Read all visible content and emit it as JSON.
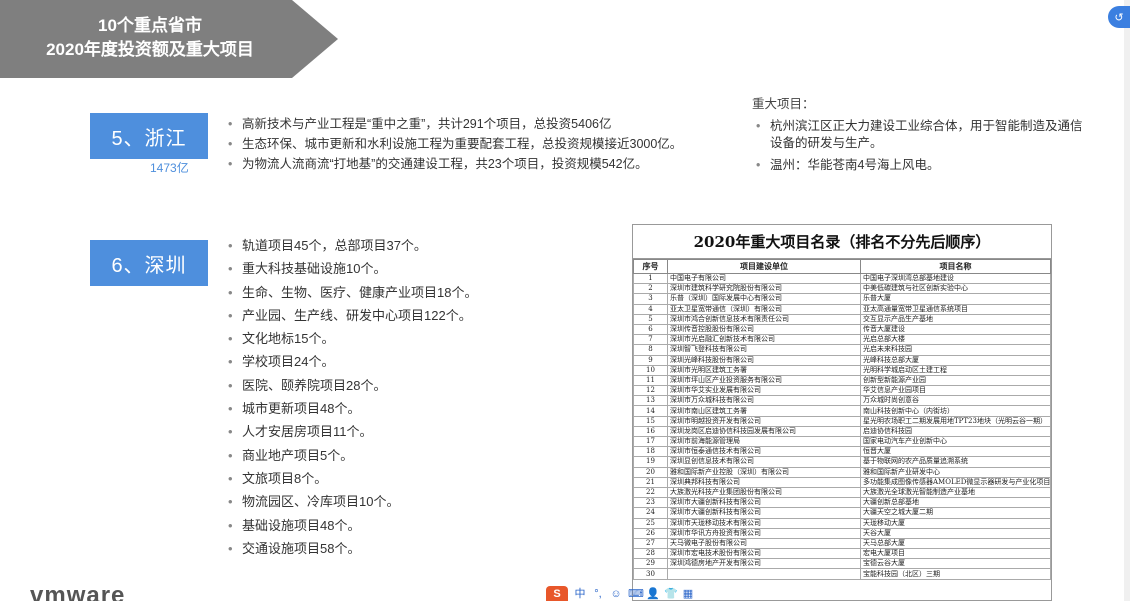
{
  "header": {
    "line1": "10个重点省市",
    "line2": "2020年度投资额及重大项目"
  },
  "zhejiang": {
    "label": "5、浙江",
    "amount": "1473亿",
    "bullets": [
      "高新技术与产业工程是“重中之重”，共计291个项目，总投资5406亿",
      "生态环保、城市更新和水利设施工程为重要配套工程，总投资规模接近3000亿。",
      "为物流人流商流“打地基”的交通建设工程，共23个项目，投资规模542亿。"
    ],
    "major_title": "重大项目：",
    "major_items": [
      "杭州滨江区正大力建设工业综合体，用于智能制造及通信设备的研发与生产。",
      "温州：华能苍南4号海上风电。"
    ]
  },
  "shenzhen": {
    "label": "6、深圳",
    "bullets": [
      "轨道项目45个，总部项目37个。",
      "重大科技基础设施10个。",
      "生命、生物、医疗、健康产业项目18个。",
      "产业园、生产线、研发中心项目122个。",
      "文化地标15个。",
      "学校项目24个。",
      "医院、颐养院项目28个。",
      "城市更新项目48个。",
      "人才安居房项目11个。",
      "商业地产项目5个。",
      "文旅项目8个。",
      "物流园区、冷库项目10个。",
      "基础设施项目48个。",
      "交通设施项目58个。"
    ]
  },
  "project_table": {
    "title": "2020年重大项目名录（排名不分先后顺序）",
    "headers": [
      "序号",
      "项目建设单位",
      "项目名称"
    ],
    "rows": [
      [
        "1",
        "中国电子有限公司",
        "中国电子深圳湾总部基地建设"
      ],
      [
        "2",
        "深圳市建筑科学研究院股份有限公司",
        "中美低碳建筑与社区创新实验中心"
      ],
      [
        "3",
        "乐普（深圳）国际发展中心有限公司",
        "乐普大厦"
      ],
      [
        "4",
        "亚太卫星宽带通信（深圳）有限公司",
        "亚太高通量宽带卫星通信系统项目"
      ],
      [
        "5",
        "深圳市鸿合创新信息技术有限责任公司",
        "交互显示产品生产基地"
      ],
      [
        "6",
        "深圳传音控股股份有限公司",
        "传音大厦建设"
      ],
      [
        "7",
        "深圳市光启融汇创新技术有限公司",
        "光启总部大楼"
      ],
      [
        "8",
        "深圳智飞登科技有限公司",
        "光启未来科技园"
      ],
      [
        "9",
        "深圳光峰科技股份有限公司",
        "光峰科技总部大厦"
      ],
      [
        "10",
        "深圳市光明区建筑工务署",
        "光明科学城启动区土建工程"
      ],
      [
        "11",
        "深圳市坪山区产业投资服务有限公司",
        "创新型新能源产业园"
      ],
      [
        "12",
        "深圳市华艾实业发展有限公司",
        "华艾信息产业园项目"
      ],
      [
        "13",
        "深圳市万众城科技有限公司",
        "万众城时尚创意谷"
      ],
      [
        "14",
        "深圳市南山区建筑工务署",
        "南山科技创新中心（内街坊）"
      ],
      [
        "15",
        "深圳市明越投资开发有限公司",
        "星光明农场职工二期发展用地TPT23地块（光明云谷一期）"
      ],
      [
        "16",
        "深圳龙岗区启迪协信科技园发展有限公司",
        "启迪协信科技园"
      ],
      [
        "17",
        "深圳市前海能源管理局",
        "国家电动汽车产业创新中心"
      ],
      [
        "18",
        "深圳市恒泰通信技术有限公司",
        "恒晋大厦"
      ],
      [
        "19",
        "深圳显创信息技术有限公司",
        "基于物联网的农产品质量追溯系统"
      ],
      [
        "20",
        "雅和国际新产业控股（深圳）有限公司",
        "雅和国际新产业研发中心"
      ],
      [
        "21",
        "深圳典邦科技有限公司",
        "多功能集成图像传感器AMOLED微显示器研发与产业化项目"
      ],
      [
        "22",
        "大族激光科技产业集团股份有限公司",
        "大族激光全球激光智能制造产业基地"
      ],
      [
        "23",
        "深圳市大疆创新科技有限公司",
        "大疆创新总部基地"
      ],
      [
        "24",
        "深圳市大疆创新科技有限公司",
        "大疆天空之城大厦二期"
      ],
      [
        "25",
        "深圳市天珑移动技术有限公司",
        "天珑移动大厦"
      ],
      [
        "26",
        "深圳市华讯方舟投资有限公司",
        "天谷大厦"
      ],
      [
        "27",
        "天马微电子股份有限公司",
        "天马总部大厦"
      ],
      [
        "28",
        "深圳市宏电技术股份有限公司",
        "宏电大厦项目"
      ],
      [
        "29",
        "深圳鸿德房地产开发有限公司",
        "宝德云谷大厦"
      ],
      [
        "30",
        "",
        "宝能科技园（北区）三期"
      ]
    ]
  },
  "footer": {
    "logo": "vmware",
    "ime_label": "S",
    "ime_icons": [
      "中",
      "°,",
      "☺",
      "⌨",
      "👤",
      "👕",
      "▦"
    ]
  },
  "corner_badge": "↺"
}
